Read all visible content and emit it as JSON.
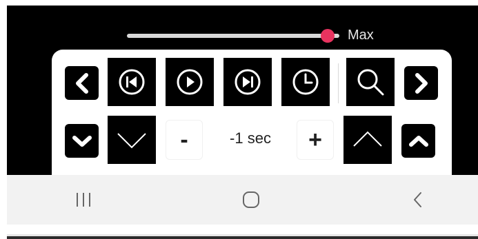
{
  "slider": {
    "label": "Max",
    "value": 0.9
  },
  "controls": {
    "prev_page_icon": "chevron-left-icon",
    "skip_back_icon": "skip-back-icon",
    "play_icon": "play-icon",
    "skip_forward_icon": "skip-forward-icon",
    "clock_icon": "clock-icon",
    "search_icon": "search-icon",
    "next_page_icon": "chevron-right-icon",
    "collapse_icon": "chevron-down-icon",
    "down_icon": "chevron-down-icon",
    "decrease_label": "-",
    "time_value": "-1 sec",
    "increase_label": "+",
    "up_icon": "chevron-up-icon",
    "expand_icon": "chevron-up-icon"
  },
  "navbar": {
    "recents_icon": "recents-icon",
    "home_icon": "home-icon",
    "back_icon": "back-icon"
  },
  "colors": {
    "accent": "#e8335f",
    "button_bg": "#000000",
    "panel_bg": "#ffffff",
    "nav_bg": "#f2f2f2"
  }
}
